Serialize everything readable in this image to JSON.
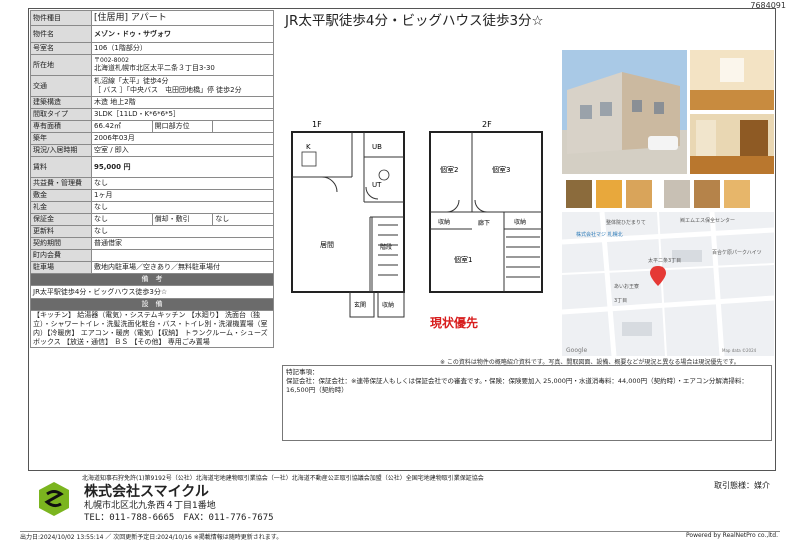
{
  "doc_number": "7684091",
  "headline": "JR太平駅徒歩4分・ビッグハウス徒歩3分☆",
  "spec": {
    "rows": [
      {
        "k": "物件種目",
        "v": "[住居用] アパート"
      },
      {
        "k": "物件名",
        "v": "メゾン・ドゥ・サヴォワ"
      },
      {
        "k": "号室名",
        "v": "106（1階部分）"
      },
      {
        "k": "所在地",
        "v1": "〒002-8002",
        "v2": "北海道札幌市北区太平二条３丁目3-30"
      },
      {
        "k": "交通",
        "v1": "札沼線「太平」徒歩4分",
        "v2": "［ バス ］「中央バス　屯田団地橋」停 徒歩2分"
      },
      {
        "k": "建築構造",
        "v": "木造 地上2階"
      },
      {
        "k": "間取タイプ",
        "v": "3LDK［11LD・K*6*6*5］"
      },
      {
        "k": "専有面積",
        "v": "66.42㎡",
        "k2": "開口部方位",
        "v2": ""
      },
      {
        "k": "築年",
        "v": "2006年03月"
      },
      {
        "k": "現況/入居時期",
        "v": "空室 / 即入"
      },
      {
        "k": "賃料",
        "v": "95,000 円"
      },
      {
        "k": "共益費・管理費",
        "v": "なし"
      },
      {
        "k": "敷金",
        "v": "1ヶ月"
      },
      {
        "k": "礼金",
        "v": "なし"
      },
      {
        "k": "保証金",
        "v": "なし",
        "k2": "償却・敷引",
        "v2": "なし"
      },
      {
        "k": "更新料",
        "v": "なし"
      },
      {
        "k": "契約期間",
        "v": "普通借家"
      },
      {
        "k": "町内会費",
        "v": ""
      },
      {
        "k": "駐車場",
        "v": "敷地内駐車場／空きあり／無料駐車場付"
      }
    ],
    "remarks_title": "備　考",
    "remarks": "JR太平駅徒歩4分・ビッグハウス徒歩3分☆",
    "equipment_title": "設　備",
    "equipment": "【キッチン】 給湯器（電気）・システムキッチン 【水廻り】 洗面台（独立）・シャワートイレ・洗髪洗面化粧台・バス・トイレ別・洗濯機置場（室内）【冷暖房】 エアコン・暖房（電気）【収納】 トランクルーム・シューズボックス 【放送・通信】 ＢＳ 【その他】 専用ごみ置場"
  },
  "floorplan": {
    "floor1": "1F",
    "floor2": "2F",
    "rooms1": [
      "K",
      "UB",
      "UT",
      "居間",
      "階段",
      "玄関",
      "収納"
    ],
    "rooms2": [
      "個室2",
      "個室3",
      "収納",
      "廊下",
      "収納",
      "個室1"
    ],
    "stamp": "現状優先"
  },
  "map": {
    "labels": [
      "整体院ひだまりて",
      "株式会社マジ 札幌北",
      "㈱エムエス保全センター",
      "百合ケ原パークハイツ",
      "太平二条3丁目",
      "あいお王寮",
      "3丁目",
      "Google",
      "Map data ©2024"
    ]
  },
  "disclaimer": "※ この資料は物件の概略紹介資料です。写真、間取図面、設備、概要などが現況と異なる場合は現況優先です。",
  "notes": {
    "title": "特記事項：",
    "text": "保証会社：保証会社：※連帯保証人もしくは保証会社での審査です。・保険：保険要加入 25,000円・水道消毒料：44,000円（契約時）・エアコン分解清掃料：16,500円（契約時）"
  },
  "footer": {
    "assoc": "北海道知事石狩免許(1)第9192号（公社）北海道宅地建物取引業協会（一社）北海道不動産公正取引協議会加盟（公社）全国宅地建物取引業保証協会",
    "company": "株式会社スマイクル",
    "address": "札幌市北区北九条西４丁目1番地",
    "tel": "TEL：011-788-6665　FAX：011-776-7675",
    "broker": "取引態様：媒介",
    "printed": "出力日:2024/10/02 13:55:14 ／ 次回更新予定日:2024/10/16 ※掲載情報は随時更新されます。",
    "powered": "Powered by RealNetPro co.,ltd."
  },
  "colors": {
    "stamp": "#d81e1e",
    "bar": "#6b6b6b",
    "key_bg": "#dcdcdc",
    "logo_green": "#7bb51f"
  }
}
